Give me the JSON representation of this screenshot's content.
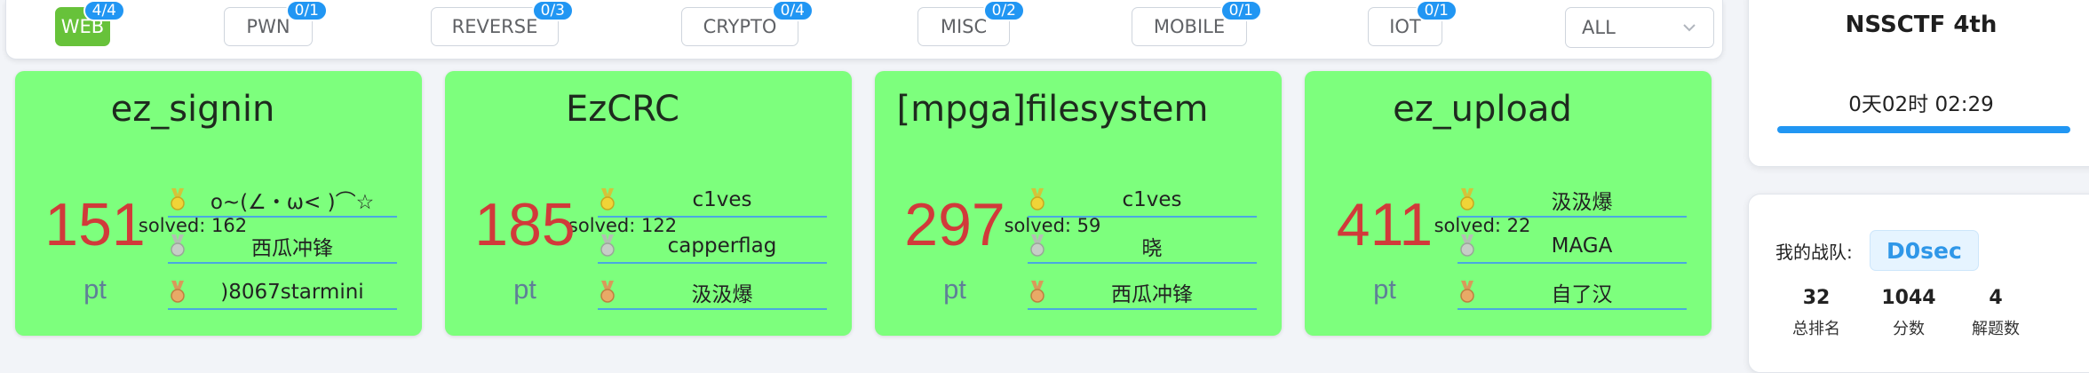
{
  "filters": {
    "categories": [
      {
        "label": "WEB",
        "badge": "4/4"
      },
      {
        "label": "PWN",
        "badge": "0/1"
      },
      {
        "label": "REVERSE",
        "badge": "0/3"
      },
      {
        "label": "CRYPTO",
        "badge": "0/4"
      },
      {
        "label": "MISC",
        "badge": "0/2"
      },
      {
        "label": "MOBILE",
        "badge": "0/1"
      },
      {
        "label": "IOT",
        "badge": "0/1"
      }
    ],
    "select_value": "ALL",
    "active_color": "#67c23a",
    "badge_color": "#2196f3"
  },
  "cards": [
    {
      "title": "ez_signin",
      "solved": "solved: 162",
      "score": "151",
      "unit": "pt",
      "solvers": [
        "o~(∠・ω< )⌒☆",
        "西瓜冲锋",
        ")8067starmini"
      ]
    },
    {
      "title": "EzCRC",
      "solved": "solved: 122",
      "score": "185",
      "unit": "pt",
      "solvers": [
        "c1ves",
        "capperflag",
        "汲汲爆"
      ]
    },
    {
      "title": "[mpga]filesystem",
      "solved": "solved: 59",
      "score": "297",
      "unit": "pt",
      "solvers": [
        "c1ves",
        "晓",
        "西瓜冲锋"
      ]
    },
    {
      "title": "ez_upload",
      "solved": "solved: 22",
      "score": "411",
      "unit": "pt",
      "solvers": [
        "汲汲爆",
        "MAGA",
        "自了汉"
      ]
    }
  ],
  "card_color": "#7dff7d",
  "contest": {
    "title": "NSSCTF 4th",
    "countdown": "0天02时 02:29"
  },
  "team": {
    "label": "我的战队:",
    "name": "D0sec",
    "stats": [
      {
        "value": "32",
        "label": "总排名"
      },
      {
        "value": "1044",
        "label": "分数"
      },
      {
        "value": "4",
        "label": "解题数"
      }
    ]
  },
  "icons": {
    "medals": [
      "gold-medal-icon",
      "silver-medal-icon",
      "bronze-medal-icon"
    ],
    "select": "chevron-down-icon"
  }
}
